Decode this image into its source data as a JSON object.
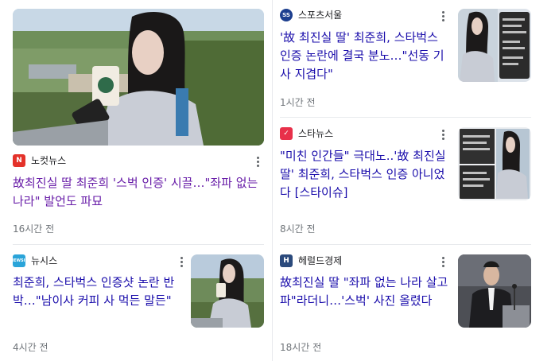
{
  "articles": [
    {
      "source": "노컷뉴스",
      "logo": "N",
      "logo_color": "#e4322a",
      "title": "故최진실 딸 최준희 '스벅 인증' 시끌…\"좌파 없는 나라\" 발언도 파묘",
      "time": "16시간 전",
      "thumb": "hero-photo-woman-drinking-coffee"
    },
    {
      "source": "뉴시스",
      "logo": "NEWSIS",
      "logo_color": "#2aa4d9",
      "title": "최준희, 스타벅스 인증샷 논란 반박…\"남이사 커피 사 먹든 말든\"",
      "time": "4시간 전",
      "thumb": "woman-drinking-coffee"
    },
    {
      "source": "스포츠서울",
      "logo": "SS",
      "logo_color": "#1d3f8f",
      "title": "'故 최진실 딸' 최준희, 스타벅스 인증 논란에 결국 분노…\"선동 기사 지겹다\"",
      "time": "1시간 전",
      "thumb": "woman-and-message-screenshot"
    },
    {
      "source": "스타뉴스",
      "logo": "✓",
      "logo_color": "#e8304a",
      "title": "\"미친 인간들\" 극대노..'故 최진실 딸' 최준희, 스타벅스 인증 아니었다 [스타이슈]",
      "time": "8시간 전",
      "thumb": "collage-screenshots"
    },
    {
      "source": "헤럴드경제",
      "logo": "H",
      "logo_color": "#2b4a7c",
      "title": "故최진실 딸 \"좌파 없는 나라 살고파\"라더니…'스벅' 사진 올렸다",
      "time": "18시간 전",
      "thumb": "man-at-podium"
    }
  ]
}
